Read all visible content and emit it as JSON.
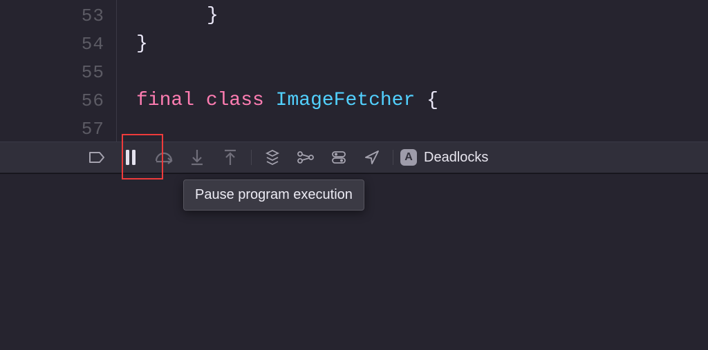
{
  "editor": {
    "lines": [
      {
        "num": "53",
        "text": "}"
      },
      {
        "num": "54",
        "text": "}"
      },
      {
        "num": "55",
        "text": ""
      },
      {
        "num": "56",
        "tokens": {
          "kw1": "final",
          "kw2": "class",
          "type": "ImageFetcher",
          "tail": " {"
        }
      },
      {
        "num": "57",
        "text": ""
      }
    ]
  },
  "toolbar": {
    "project_name": "Deadlocks",
    "app_badge": "A"
  },
  "tooltip": {
    "text": "Pause program execution"
  }
}
